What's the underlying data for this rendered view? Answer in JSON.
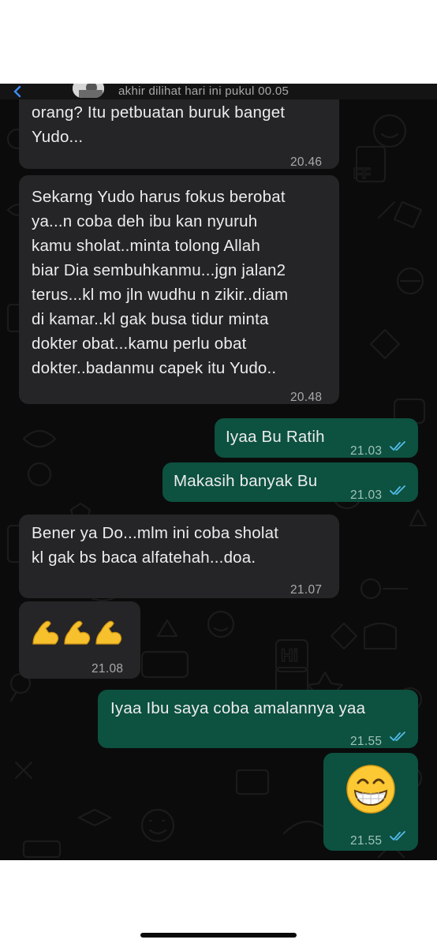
{
  "header": {
    "last_seen": "akhir dilihat hari ini pukul 00.05"
  },
  "messages": [
    {
      "direction": "incoming",
      "text": "Nah...mau gak kamu diludahin\norang? Itu petbuatan buruk banget\nYudo...",
      "time": "20.46"
    },
    {
      "direction": "incoming",
      "text": "Sekarng Yudo harus fokus berobat\nya...n coba deh ibu kan nyuruh\nkamu sholat..minta tolong Allah\nbiar Dia sembuhkanmu...jgn jalan2\nterus...kl mo jln wudhu n zikir..diam\ndi kamar..kl gak busa tidur minta\ndokter obat...kamu perlu obat\ndokter..badanmu capek itu Yudo..",
      "time": "20.48"
    },
    {
      "direction": "outgoing",
      "text": "Iyaa Bu Ratih",
      "time": "21.03",
      "status": "read"
    },
    {
      "direction": "outgoing",
      "text": "Makasih banyak Bu",
      "time": "21.03",
      "status": "read"
    },
    {
      "direction": "incoming",
      "text": "Bener ya Do...mlm ini coba sholat\nkl gak bs baca alfatehah...doa.",
      "time": "21.07"
    },
    {
      "direction": "incoming",
      "emoji": "flexed-biceps x3",
      "time": "21.08"
    },
    {
      "direction": "outgoing",
      "text": "Iyaa Ibu saya coba amalannya yaa",
      "time": "21.55",
      "status": "read"
    },
    {
      "direction": "outgoing",
      "emoji": "grinning-face-with-smiling-eyes",
      "time": "21.55",
      "status": "read"
    }
  ],
  "colors": {
    "chat_background": "#0b0b0b",
    "incoming_bubble": "#252527",
    "outgoing_bubble": "#0d5140",
    "read_tick": "#53bdeb"
  }
}
